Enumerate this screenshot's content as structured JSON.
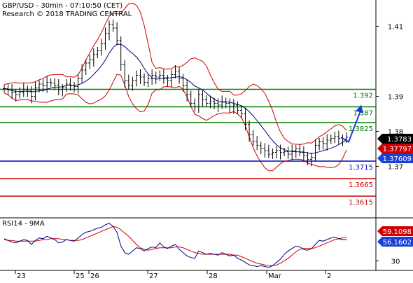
{
  "header": {
    "line1": "GBP/USD - 30min - 07:10:50 (CET)",
    "line2": "Research © 2018 TRADING CENTRAL"
  },
  "colors": {
    "candle": "#000000",
    "bollinger": "#cc0000",
    "moving_average": "#000080",
    "resistance": "#008000",
    "pivot": "#0000cc",
    "support": "#cc0000",
    "forecast_arrow": "#1a3fd6",
    "current_price_tag": "#000000",
    "price_tag_red": "#cc0000",
    "price_tag_blue": "#1a3fd6",
    "rsi_line": "#000080",
    "rsi_ma": "#cc0000",
    "axis_text": "#000000",
    "separator": "#000000"
  },
  "chart_data": [
    {
      "type": "candlestick",
      "title": "GBP/USD - 30min - 07:10:50 (CET)",
      "y_ticks": [
        "1.41",
        "1.39",
        "1.38",
        "1.37",
        "30"
      ],
      "x_ticks": [
        "23",
        "25",
        "26",
        "27",
        "28",
        "Mar",
        "2"
      ],
      "ylim": [
        1.3575,
        1.4165
      ],
      "horizontal_levels": [
        {
          "value": 1.392,
          "label": "1.392",
          "role": "resistance"
        },
        {
          "value": 1.387,
          "label": "1.387",
          "role": "resistance"
        },
        {
          "value": 1.3825,
          "label": "1.3825",
          "role": "resistance"
        },
        {
          "value": 1.3715,
          "label": "1.3715",
          "role": "pivot"
        },
        {
          "value": 1.3665,
          "label": "1.3665",
          "role": "support"
        },
        {
          "value": 1.3615,
          "label": "1.3615",
          "role": "support"
        }
      ],
      "price_tags": [
        {
          "value": 1.3783,
          "label": "1.3783",
          "style": "current"
        },
        {
          "value": 1.37797,
          "label": "1.37797",
          "style": "red"
        },
        {
          "value": 1.37609,
          "label": "1.37609",
          "style": "blue"
        }
      ],
      "closes": [
        1.3922,
        1.3918,
        1.391,
        1.3905,
        1.3912,
        1.392,
        1.3915,
        1.39,
        1.3925,
        1.3935,
        1.393,
        1.394,
        1.3938,
        1.3932,
        1.392,
        1.3924,
        1.3935,
        1.393,
        1.3928,
        1.395,
        1.3975,
        1.3995,
        1.4005,
        1.402,
        1.403,
        1.405,
        1.408,
        1.4105,
        1.4095,
        1.406,
        1.399,
        1.3945,
        1.393,
        1.3945,
        1.396,
        1.3955,
        1.394,
        1.395,
        1.396,
        1.3955,
        1.396,
        1.395,
        1.3945,
        1.3962,
        1.3972,
        1.395,
        1.393,
        1.3905,
        1.388,
        1.387,
        1.3905,
        1.389,
        1.388,
        1.3885,
        1.388,
        1.3875,
        1.3885,
        1.388,
        1.387,
        1.3875,
        1.386,
        1.385,
        1.382,
        1.379,
        1.377,
        1.376,
        1.3752,
        1.3745,
        1.3735,
        1.374,
        1.3745,
        1.374,
        1.3742,
        1.3735,
        1.3745,
        1.375,
        1.374,
        1.373,
        1.372,
        1.3725,
        1.376,
        1.377,
        1.3765,
        1.3775,
        1.378,
        1.3785,
        1.378,
        1.3778,
        1.3783
      ],
      "forecast_path": [
        1.377,
        1.387
      ],
      "rsi": {
        "label": "RSI14 - 9MA",
        "tags": [
          {
            "value": 59.1098,
            "label": "59.1098",
            "style": "red"
          },
          {
            "value": 56.1602,
            "label": "56.1602",
            "style": "blue"
          }
        ],
        "y_tick": "30",
        "ylim": [
          20,
          80
        ],
        "values": [
          57,
          55,
          53,
          52,
          54,
          56,
          55,
          50,
          55,
          58,
          57,
          60,
          58,
          56,
          52,
          53,
          56,
          55,
          54,
          58,
          62,
          65,
          66,
          68,
          70,
          71,
          74,
          76,
          72,
          65,
          48,
          40,
          38,
          42,
          46,
          45,
          42,
          45,
          47,
          46,
          52,
          47,
          45,
          48,
          50,
          44,
          40,
          36,
          34,
          33,
          42,
          40,
          38,
          39,
          38,
          37,
          40,
          38,
          36,
          37,
          33,
          31,
          28,
          25,
          24,
          23,
          24,
          23,
          22,
          24,
          28,
          32,
          38,
          42,
          45,
          48,
          47,
          44,
          43,
          45,
          50,
          55,
          54,
          56,
          58,
          59,
          57,
          56,
          56
        ],
        "ma_values": [
          56,
          55,
          55,
          54,
          54,
          54,
          54,
          54,
          54,
          55,
          56,
          56,
          57,
          57,
          57,
          56,
          56,
          55,
          55,
          55,
          56,
          58,
          60,
          62,
          64,
          66,
          68,
          70,
          72,
          71,
          68,
          64,
          60,
          55,
          50,
          46,
          44,
          43,
          44,
          45,
          46,
          46,
          46,
          46,
          47,
          47,
          46,
          44,
          42,
          40,
          39,
          38,
          38,
          38,
          38,
          38,
          38,
          38,
          38,
          37,
          37,
          35,
          33,
          31,
          29,
          27,
          26,
          25,
          24,
          24,
          25,
          27,
          30,
          33,
          37,
          41,
          44,
          45,
          45,
          45,
          46,
          48,
          50,
          52,
          54,
          56,
          57,
          58,
          59
        ]
      }
    }
  ]
}
